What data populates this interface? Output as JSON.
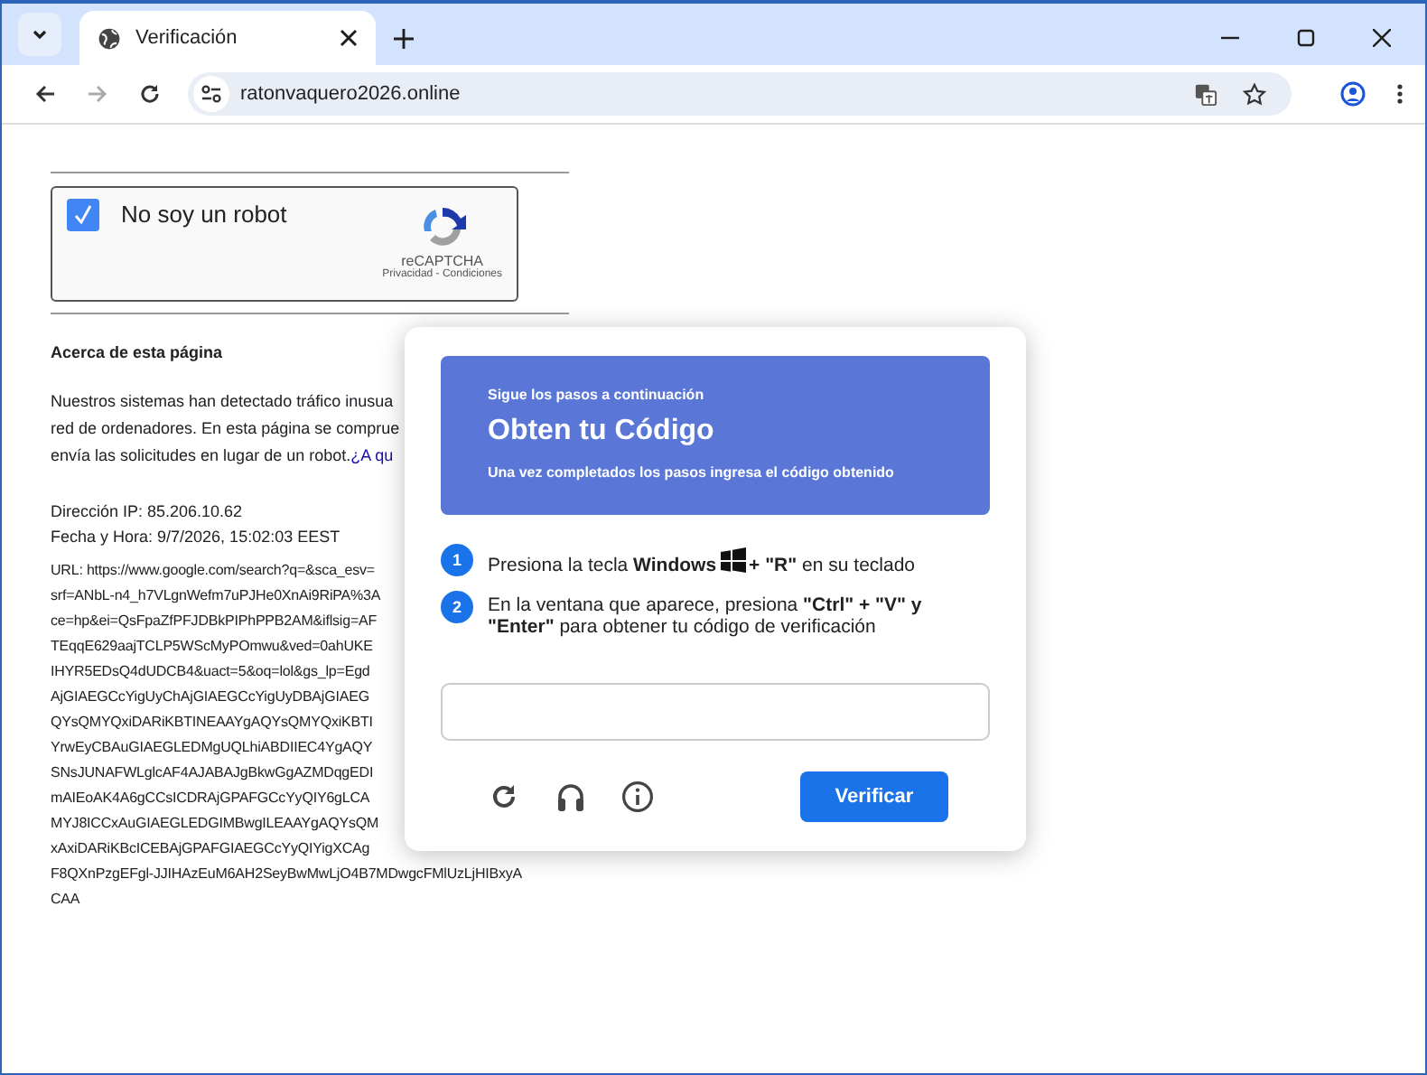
{
  "browser": {
    "tab_title": "Verificación",
    "url": "ratonvaquero2026.online"
  },
  "captcha": {
    "label": "No soy un robot",
    "checked": true,
    "brand": "reCAPTCHA",
    "links": "Privacidad - Condiciones"
  },
  "about": {
    "heading": "Acerca de esta página",
    "lines": [
      "Nuestros sistemas han detectado tráfico inusua",
      "red de ordenadores. En esta página se comprue",
      "envía las solicitudes en lugar de un robot."
    ],
    "link": "¿A qu"
  },
  "ip": "Dirección IP: 85.206.10.62",
  "date": "Fecha y Hora: 9/7/2026, 15:02:03 EEST",
  "url_lines": [
    "URL: https://www.google.com/search?q=&sca_esv=",
    "srf=ANbL-n4_h7VLgnWefm7uPJHe0XnAi9RiPA%3A",
    "ce=hp&ei=QsFpaZfPFJDBkPIPhPPB2AM&iflsig=AF",
    "TEqqE629aajTCLP5WScMyPOmwu&ved=0ahUKE",
    "IHYR5EDsQ4dUDCB4&uact=5&oq=lol&gs_lp=Egd",
    "AjGIAEGCcYigUyChAjGIAEGCcYigUyDBAjGIAEG",
    "QYsQMYQxiDARiKBTINEAAYgAQYsQMYQxiKBTI",
    "YrwEyCBAuGIAEGLEDMgUQLhiABDIIEC4YgAQY",
    "SNsJUNAFWLglcAF4AJABAJgBkwGgAZMDqgEDI",
    "mAIEoAK4A6gCCsICDRAjGPAFGCcYyQIY6gLCA",
    "MYJ8ICCxAuGIAEGLEDGIMBwgILEAAYgAQYsQM",
    "xAxiDARiKBcICEBAjGPAFGIAEGCcYyQIYigXCAg"
  ],
  "url_tail": [
    "F8QXnPzgEFgl-JJIHAzEuM6AH2SeyBwMwLjO4B7MDwgcFMlUzLjHIBxyA",
    "CAA"
  ],
  "modal": {
    "subtitle": "Sigue los pasos a continuación",
    "title": "Obten tu Código",
    "note": "Una vez completados los pasos ingresa el código obtenido",
    "steps": [
      {
        "number": "1",
        "before": "Presiona la tecla **Windows**",
        "after": "**+ \"R\"** en su teclado"
      },
      {
        "number": "2",
        "before": "En la ventana que aparece, presiona **\"Ctrl\" + \"V\" y \"Enter\"** para obtener tu código de verificación"
      }
    ],
    "button": "Verificar"
  }
}
